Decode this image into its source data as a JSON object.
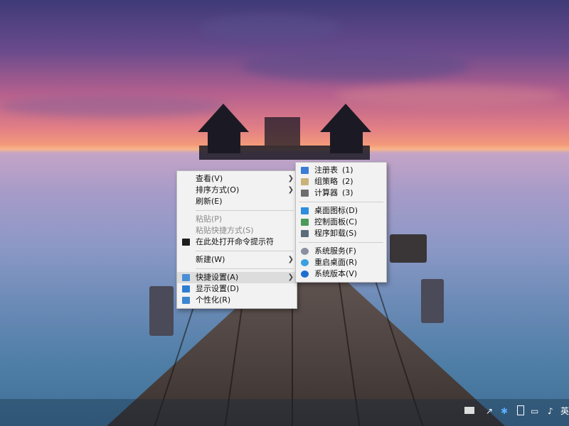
{
  "desktop": {
    "background_colors": {
      "sky_top": "#3f3a78",
      "sunset": "#f39a7a",
      "water": "#6e8cb8",
      "pier": "#4a403d"
    }
  },
  "context_menu": {
    "items": [
      {
        "label": "查看(V)",
        "has_submenu": true
      },
      {
        "label": "排序方式(O)",
        "has_submenu": true
      },
      {
        "label": "刷新(E)"
      },
      {
        "label": "粘贴(P)",
        "disabled": true
      },
      {
        "label": "粘贴快捷方式(S)",
        "disabled": true
      },
      {
        "label": "在此处打开命令提示符",
        "icon": "cmd-icon"
      },
      {
        "label": "新建(W)",
        "has_submenu": true
      },
      {
        "label": "快捷设置(A)",
        "has_submenu": true,
        "highlighted": true,
        "icon": "quick-settings-icon"
      },
      {
        "label": "显示设置(D)",
        "icon": "display-icon"
      },
      {
        "label": "个性化(R)",
        "icon": "personalize-icon"
      }
    ]
  },
  "submenu": {
    "items": [
      {
        "label": "注册表",
        "num": "(1)",
        "icon": "registry-icon"
      },
      {
        "label": "组策略",
        "num": "(2)",
        "icon": "policy-icon"
      },
      {
        "label": "计算器",
        "num": "(3)",
        "icon": "calculator-icon"
      },
      {
        "label": "桌面图标(D)",
        "icon": "desktop-icon"
      },
      {
        "label": "控制面板(C)",
        "icon": "control-panel-icon"
      },
      {
        "label": "程序卸载(S)",
        "icon": "uninstall-icon"
      },
      {
        "label": "系统服务(F)",
        "icon": "services-icon"
      },
      {
        "label": "重启桌面(R)",
        "icon": "restart-icon"
      },
      {
        "label": "系统版本(V)",
        "icon": "info-icon"
      }
    ]
  },
  "taskbar": {
    "tray": {
      "language": "英"
    }
  }
}
